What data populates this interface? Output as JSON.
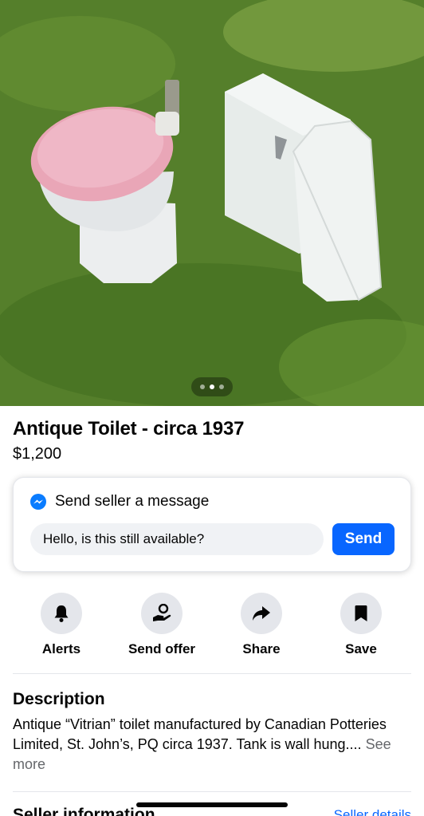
{
  "listing": {
    "title": "Antique Toilet - circa 1937",
    "price": "$1,200",
    "photo_alt_icon": "listing-photo",
    "carousel_dots": 3,
    "carousel_active_index": 1
  },
  "message": {
    "header_label": "Send seller a message",
    "input_value": "Hello, is this still available?",
    "send_label": "Send",
    "icon": "messenger-icon",
    "accent": "#0866ff"
  },
  "actions": [
    {
      "label": "Alerts",
      "icon": "bell-icon"
    },
    {
      "label": "Send offer",
      "icon": "offer-icon"
    },
    {
      "label": "Share",
      "icon": "share-icon"
    },
    {
      "label": "Save",
      "icon": "bookmark-icon"
    }
  ],
  "description": {
    "heading": "Description",
    "text": "Antique “Vitrian” toilet manufactured by Canadian Potteries Limited, St. John’s, PQ circa 1937.  Tank is wall hung....",
    "see_more": "See more"
  },
  "seller": {
    "heading": "Seller information",
    "link": "Seller details"
  }
}
